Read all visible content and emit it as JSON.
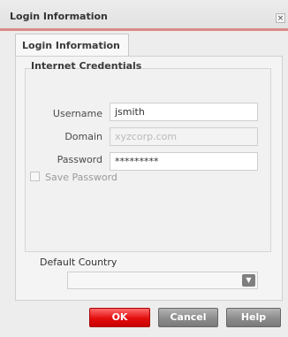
{
  "window": {
    "title": "Login Information",
    "close_glyph": "×"
  },
  "tab": {
    "label": "Login Information"
  },
  "credentials": {
    "heading": "Internet Credentials",
    "username_label": "Username",
    "username_value": "jsmith",
    "domain_label": "Domain",
    "domain_value": "xyzcorp.com",
    "password_label": "Password",
    "password_value": "*********",
    "save_password_label": "Save Password",
    "save_password_checked": false
  },
  "country": {
    "label": "Default Country",
    "selected": ""
  },
  "buttons": {
    "ok": "OK",
    "cancel": "Cancel",
    "help": "Help"
  },
  "colors": {
    "accent": "#e20e0e",
    "title_underline": "#d98a8a"
  }
}
